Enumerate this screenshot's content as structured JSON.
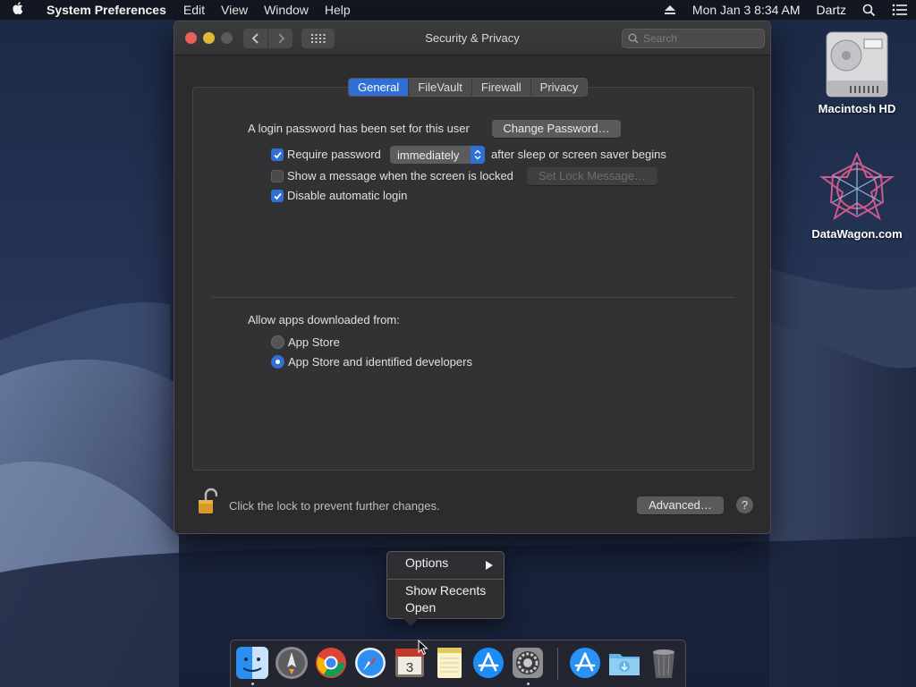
{
  "menubar": {
    "app_name": "System Preferences",
    "menus": [
      "Edit",
      "View",
      "Window",
      "Help"
    ],
    "datetime": "Mon Jan 3  8:34 AM",
    "user": "Dartz"
  },
  "window": {
    "title": "Security & Privacy",
    "search_placeholder": "Search",
    "tabs": [
      {
        "label": "General",
        "active": true
      },
      {
        "label": "FileVault",
        "active": false
      },
      {
        "label": "Firewall",
        "active": false
      },
      {
        "label": "Privacy",
        "active": false
      }
    ],
    "general": {
      "login_password_text": "A login password has been set for this user",
      "change_password_label": "Change Password…",
      "require_password": {
        "label": "Require password",
        "checked": true,
        "delay_value": "immediately",
        "suffix": "after sleep or screen saver begins"
      },
      "show_message": {
        "label": "Show a message when the screen is locked",
        "checked": false,
        "button_label": "Set Lock Message…"
      },
      "disable_autologin": {
        "label": "Disable automatic login",
        "checked": true
      },
      "allow_apps_label": "Allow apps downloaded from:",
      "allow_options": [
        {
          "label": "App Store",
          "selected": false
        },
        {
          "label": "App Store and identified developers",
          "selected": true
        }
      ]
    },
    "footer": {
      "lock_text": "Click the lock to prevent further changes.",
      "advanced_label": "Advanced…",
      "help_label": "?"
    }
  },
  "desktop": {
    "icons": [
      {
        "label": "Macintosh HD",
        "icon": "hard-drive-icon"
      },
      {
        "label": "DataWagon.com",
        "icon": "datawagon-logo-icon"
      }
    ]
  },
  "context_menu": {
    "items": [
      {
        "label": "Options",
        "submenu": true
      },
      {
        "label": "Show Recents",
        "submenu": false
      },
      {
        "label": "Open",
        "submenu": false
      }
    ]
  },
  "dock": {
    "apps": [
      {
        "name": "finder-icon",
        "running": true
      },
      {
        "name": "launchpad-icon",
        "running": false
      },
      {
        "name": "chrome-icon",
        "running": false
      },
      {
        "name": "safari-icon",
        "running": false
      },
      {
        "name": "calendar-icon",
        "running": false,
        "badge": "3"
      },
      {
        "name": "notes-icon",
        "running": false
      },
      {
        "name": "app-store-icon",
        "running": false
      },
      {
        "name": "system-preferences-icon",
        "running": true
      },
      {
        "name": "app-store-downloads-icon",
        "running": false
      },
      {
        "name": "downloads-folder-icon",
        "running": false
      },
      {
        "name": "trash-icon",
        "running": false
      }
    ]
  },
  "colors": {
    "accent": "#2f6fd6",
    "window_bg": "#2c2c2e",
    "close": "#ec5f57",
    "minimize": "#e0b83a"
  }
}
